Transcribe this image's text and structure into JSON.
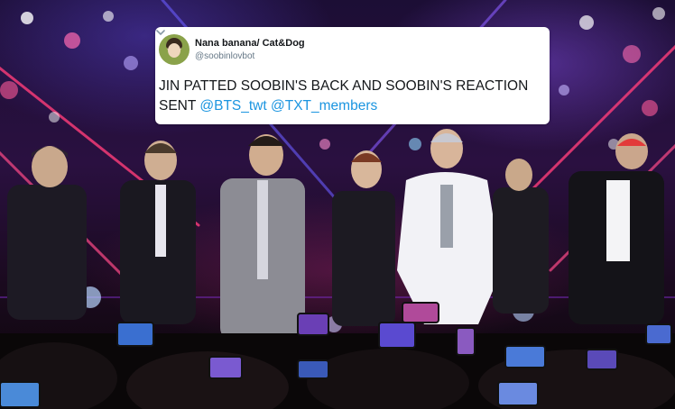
{
  "tweet": {
    "display_name": "Nana banana/ Cat&Dog",
    "handle": "@soobinlovbot",
    "text": "JIN PATTED SOOBIN'S BACK AND SOOBIN'S REACTION SENT",
    "mentions": [
      "@BTS_twt",
      "@TXT_members"
    ],
    "menu_icon": "chevron-down-icon"
  },
  "colors": {
    "mention": "#1b95e0",
    "handle": "#657786",
    "text": "#14171a"
  }
}
